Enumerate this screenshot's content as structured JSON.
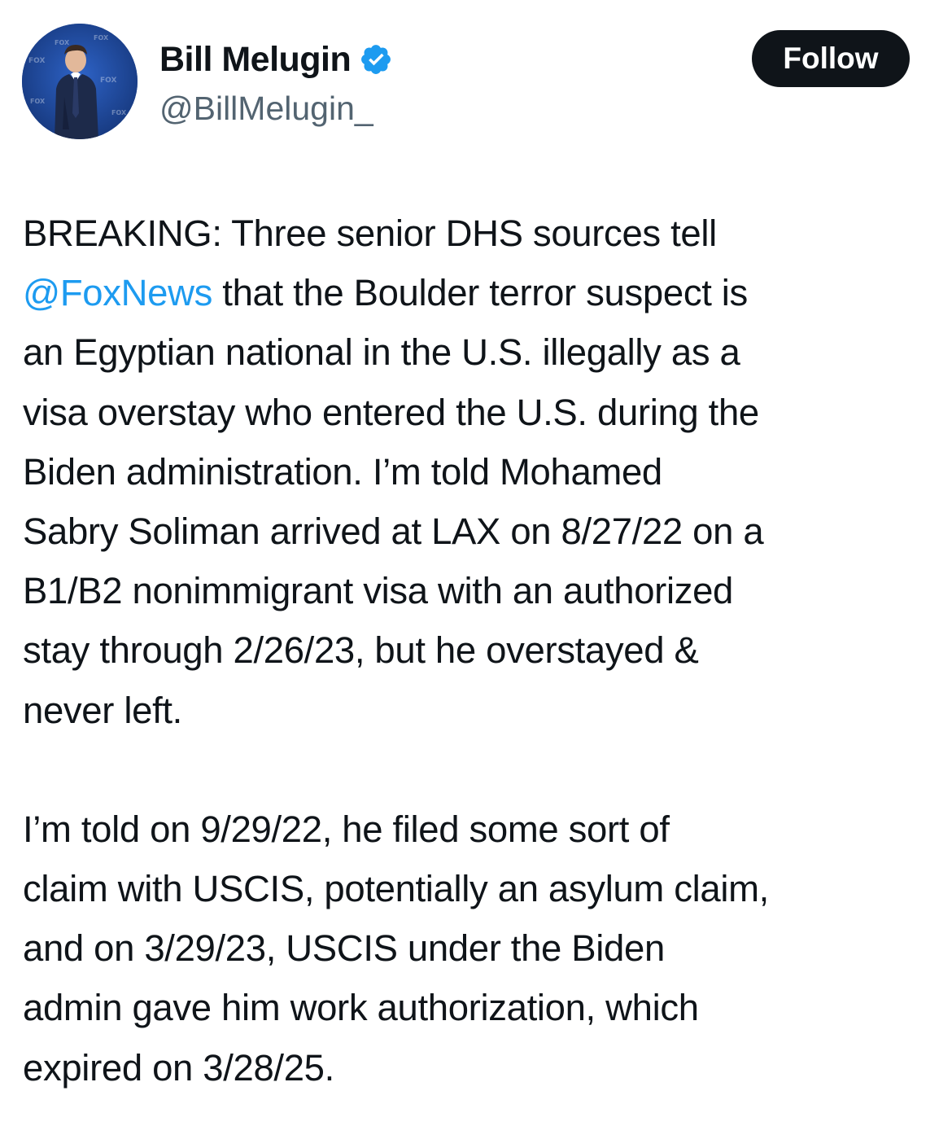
{
  "author": {
    "display_name": "Bill Melugin",
    "handle": "@BillMelugin_",
    "verified": true,
    "verified_color": "#1d9bf0",
    "avatar_icon": "profile-photo"
  },
  "actions": {
    "follow_label": "Follow"
  },
  "tweet": {
    "paragraphs": [
      {
        "lines": [
          [
            {
              "t": "BREAKING: Three senior DHS sources tell"
            }
          ],
          [
            {
              "t": "@FoxNews",
              "mention": true
            },
            {
              "t": " that the Boulder terror suspect is"
            }
          ],
          [
            {
              "t": "an Egyptian national in the U.S. illegally as a"
            }
          ],
          [
            {
              "t": "visa overstay who entered the U.S. during the"
            }
          ],
          [
            {
              "t": "Biden administration. I’m told Mohamed"
            }
          ],
          [
            {
              "t": "Sabry Soliman arrived at LAX on 8/27/22 on a"
            }
          ],
          [
            {
              "t": "B1/B2 nonimmigrant visa with an authorized"
            }
          ],
          [
            {
              "t": "stay through 2/26/23, but he overstayed &"
            }
          ],
          [
            {
              "t": "never left."
            }
          ]
        ]
      },
      {
        "lines": [
          [
            {
              "t": "I’m told on 9/29/22, he filed some sort of"
            }
          ],
          [
            {
              "t": "claim with USCIS, potentially an asylum claim,"
            }
          ],
          [
            {
              "t": "and on 3/29/23, USCIS under the Biden"
            }
          ],
          [
            {
              "t": "admin gave him work authorization, which"
            }
          ],
          [
            {
              "t": "expired on 3/28/25."
            }
          ]
        ]
      }
    ]
  },
  "colors": {
    "text": "#0f1419",
    "secondary_text": "#536471",
    "link": "#1d9bf0",
    "button_bg": "#0f1419",
    "button_text": "#ffffff"
  }
}
